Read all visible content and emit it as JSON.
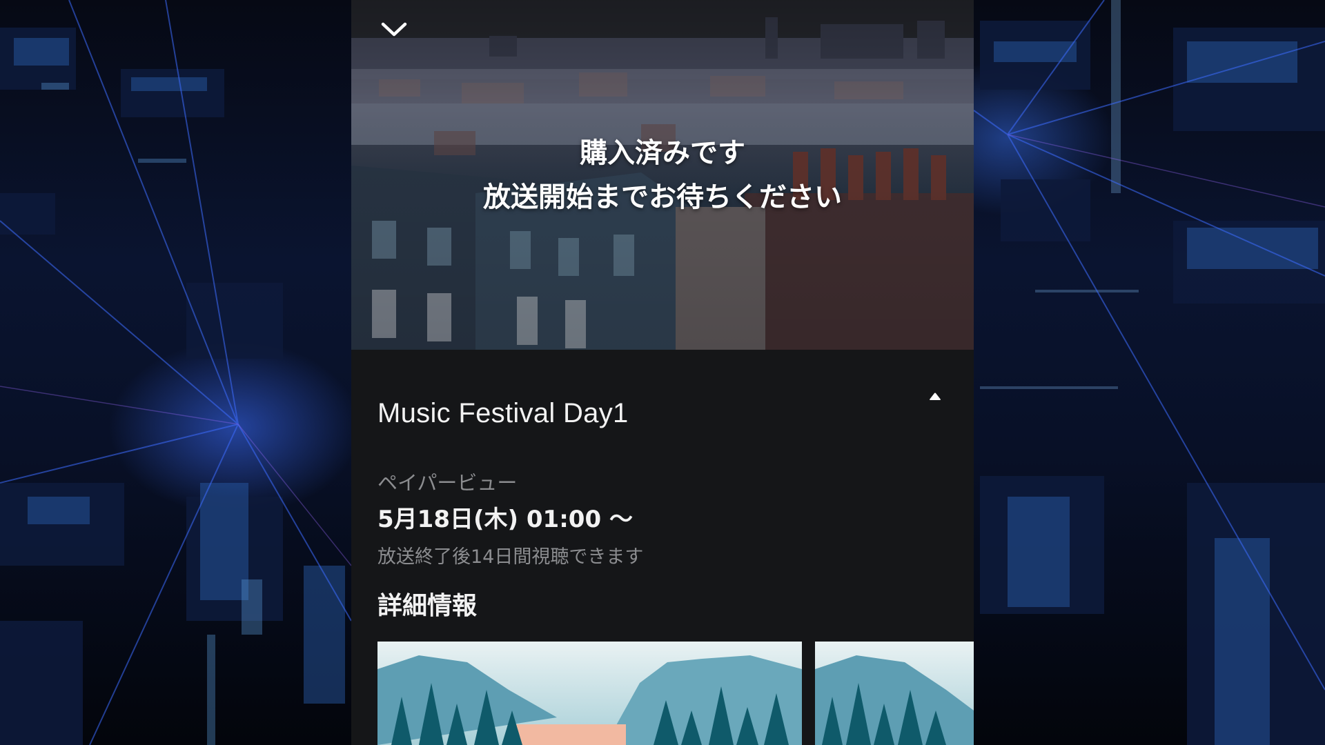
{
  "hero": {
    "status_line_1": "購入済みです",
    "status_line_2": "放送開始までお待ちください",
    "collapse_icon": "chevron-down-icon"
  },
  "event": {
    "title": "Music Festival Day1",
    "toggle_icon": "caret-up-icon",
    "type_label": "ペイパービュー",
    "datetime": "5月18日(木) 01:00 〜",
    "availability_note": "放送終了後14日間視聴できます"
  },
  "details": {
    "section_title": "詳細情報",
    "thumbnails": [
      {
        "name": "mountain-forest-thumbnail"
      },
      {
        "name": "mountain-forest-thumbnail"
      }
    ]
  },
  "colors": {
    "panel_bg": "#151618",
    "text_primary": "#f2f2f2",
    "text_secondary": "#8c8d90",
    "background_accent": "#1e46c8"
  }
}
